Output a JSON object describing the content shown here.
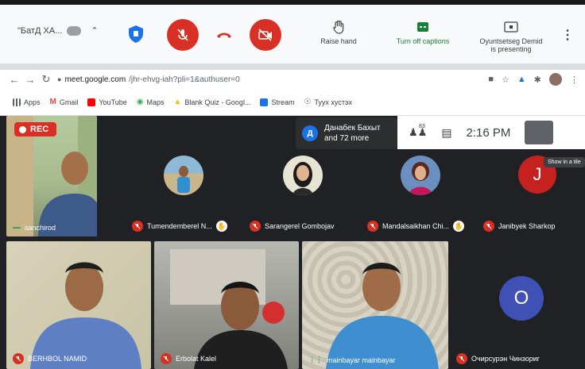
{
  "meet_bar": {
    "presenter_chip": "\"БатД ХА...",
    "raise_hand_label": "Raise hand",
    "captions_label": "Turn off captions",
    "presenting_line1": "Oyuntsetseg Demid",
    "presenting_line2": "is presenting"
  },
  "browser": {
    "url_host": "meet.google.com",
    "url_path": "/jhr-ehvg-iah?pli=1&authuser=0",
    "bookmarks": [
      {
        "label": "Apps",
        "color": "#5f6368"
      },
      {
        "label": "Gmail",
        "color": "#ea4335"
      },
      {
        "label": "YouTube",
        "color": "#ff0000"
      },
      {
        "label": "Maps",
        "color": "#34a853"
      },
      {
        "label": "Blank Quiz - Googl...",
        "color": "#4285f4"
      },
      {
        "label": "Stream",
        "color": "#1a73e8"
      },
      {
        "label": "Тууx хуcтэх",
        "color": "#5f6368"
      }
    ]
  },
  "meeting": {
    "rec_label": "REC",
    "joined_avatar_letter": "Д",
    "joined_line1": "Данабек Бахыт",
    "joined_line2": "and 72 more",
    "people_count": "83",
    "clock": "2:16 PM",
    "tooltip": "Show in a tile",
    "tiles": [
      {
        "name": "sanchirod",
        "kind": "video-green"
      },
      {
        "name": "Tumendemberel N...",
        "kind": "avatar-photo"
      },
      {
        "name": "Sarangerel Gombojav",
        "kind": "avatar-photo"
      },
      {
        "name": "Mandalsaikhan Chi...",
        "kind": "avatar-photo"
      },
      {
        "name": "Janibyek Sharkop",
        "kind": "avatar-letter",
        "letter": "J"
      },
      {
        "name": "BERHBOL NAMID",
        "kind": "video"
      },
      {
        "name": "Erbolat Kalel",
        "kind": "video"
      },
      {
        "name": "mainbayar mainbayar",
        "kind": "video"
      },
      {
        "name": "Очирсурэн Чинзориг",
        "kind": "avatar-letter",
        "letter": "O"
      }
    ]
  },
  "colors": {
    "danger": "#d93025",
    "meet_bg": "#202124",
    "caption_green": "#188038",
    "avatar_letter_j": "#c5221f",
    "avatar_letter_o": "#3f51b5"
  }
}
